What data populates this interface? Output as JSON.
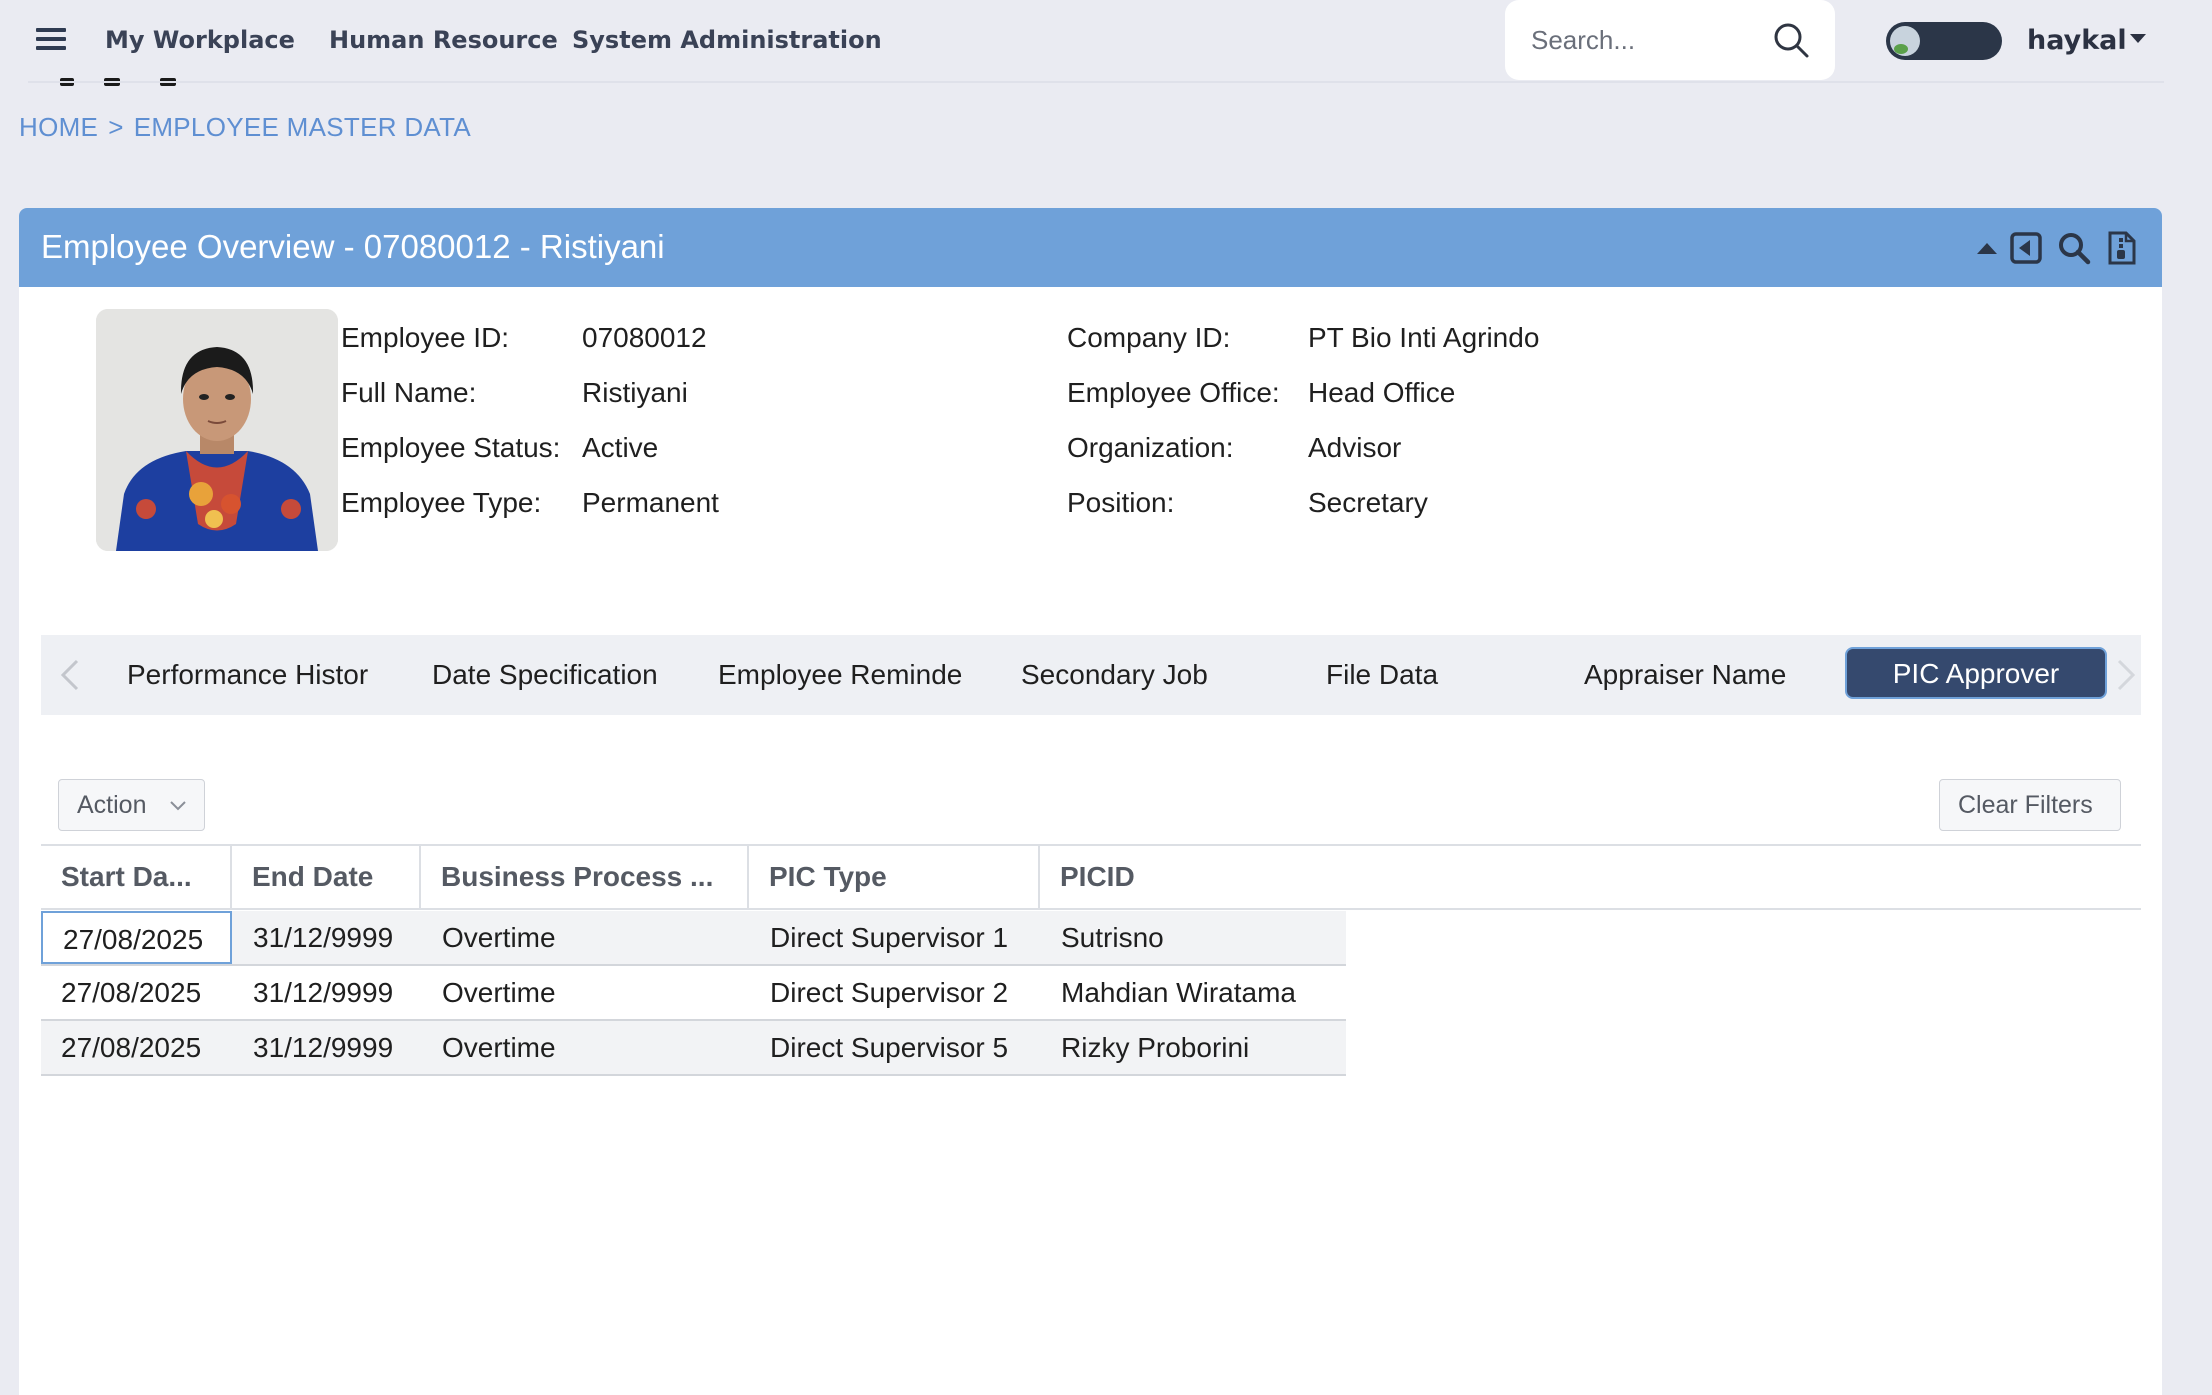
{
  "nav": {
    "items": [
      {
        "label": "My Workplace"
      },
      {
        "label": "Human Resource"
      },
      {
        "label": "System Administration"
      }
    ],
    "search_placeholder": "Search...",
    "user_name": "haykal"
  },
  "breadcrumb": {
    "home": "HOME",
    "separator": ">",
    "current": "EMPLOYEE MASTER DATA"
  },
  "panel": {
    "title": "Employee Overview - 07080012 - Ristiyani"
  },
  "employee": {
    "left": [
      {
        "label": "Employee ID:",
        "value": "07080012"
      },
      {
        "label": "Full Name:",
        "value": "Ristiyani"
      },
      {
        "label": "Employee Status:",
        "value": "Active"
      },
      {
        "label": "Employee Type:",
        "value": "Permanent"
      }
    ],
    "right": [
      {
        "label": "Company ID:",
        "value": "PT Bio Inti Agrindo"
      },
      {
        "label": "Employee Office:",
        "value": "Head Office"
      },
      {
        "label": "Organization:",
        "value": "Advisor"
      },
      {
        "label": "Position:",
        "value": "Secretary"
      }
    ]
  },
  "tabs": [
    {
      "label": "Performance Histor"
    },
    {
      "label": "Date Specification"
    },
    {
      "label": "Employee Reminde"
    },
    {
      "label": "Secondary Job"
    },
    {
      "label": "File Data"
    },
    {
      "label": "Appraiser Name"
    },
    {
      "label": "PIC Approver"
    }
  ],
  "active_tab": "PIC Approver",
  "toolbar": {
    "action_label": "Action",
    "clear_filters_label": "Clear Filters"
  },
  "grid": {
    "columns": [
      "Start Da...",
      "End Date",
      "Business Process ...",
      "PIC Type",
      "PICID"
    ],
    "rows": [
      [
        "27/08/2025",
        "31/12/9999",
        "Overtime",
        "Direct Supervisor 1",
        "Sutrisno"
      ],
      [
        "27/08/2025",
        "31/12/9999",
        "Overtime",
        "Direct Supervisor 2",
        "Mahdian Wiratama"
      ],
      [
        "27/08/2025",
        "31/12/9999",
        "Overtime",
        "Direct Supervisor 5",
        "Rizky Proborini"
      ]
    ]
  },
  "colors": {
    "header_blue": "#6fa1d9",
    "active_tab": "#35496e",
    "breadcrumb": "#5f8fd2"
  }
}
